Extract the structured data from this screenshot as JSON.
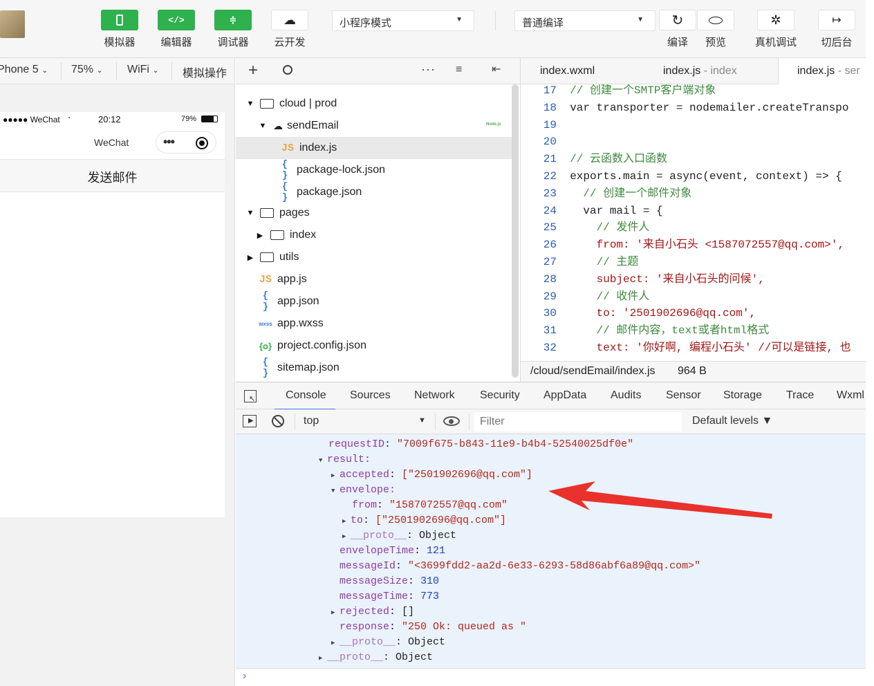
{
  "toolbar": {
    "simulator": "模拟器",
    "editor": "编辑器",
    "debugger": "调试器",
    "cloud": "云开发",
    "mode": "小程序模式",
    "compile_mode": "普通编译",
    "compile": "编译",
    "preview": "预览",
    "device_debug": "真机调试",
    "background": "切后台"
  },
  "sim_bar": {
    "device": "Phone 5",
    "zoom": "75%",
    "network": "WiFi",
    "actions": "模拟操作"
  },
  "phone": {
    "carrier": "●●●●● WeChat",
    "time": "20:12",
    "battery": "79%",
    "title": "WeChat",
    "button": "发送邮件"
  },
  "file_tree": [
    {
      "label": "cloud | prod"
    },
    {
      "label": "sendEmail",
      "badge": "Node.js"
    },
    {
      "label": "index.js"
    },
    {
      "label": "package-lock.json"
    },
    {
      "label": "package.json"
    },
    {
      "label": "pages"
    },
    {
      "label": "index"
    },
    {
      "label": "utils"
    },
    {
      "label": "app.js"
    },
    {
      "label": "app.json"
    },
    {
      "label": "app.wxss"
    },
    {
      "label": "project.config.json"
    },
    {
      "label": "sitemap.json"
    }
  ],
  "editor_tabs": {
    "tab1": "index.wxml",
    "tab2_name": "index.js",
    "tab2_sub": " - index",
    "tab3_name": "index.js",
    "tab3_sub": " - ser"
  },
  "code": [
    {
      "n": "17",
      "t": "  // 创建一个SMTP客户端对象"
    },
    {
      "n": "18",
      "t": "  var transporter = nodemailer.createTranspo"
    },
    {
      "n": "19",
      "t": ""
    },
    {
      "n": "20",
      "t": ""
    },
    {
      "n": "21",
      "t": "  // 云函数入口函数"
    },
    {
      "n": "22",
      "t": "  exports.main = async(event, context) => {"
    },
    {
      "n": "23",
      "t": "    // 创建一个邮件对象"
    },
    {
      "n": "24",
      "t": "    var mail = {"
    },
    {
      "n": "25",
      "t": "      // 发件人"
    },
    {
      "n": "26",
      "t": "      from: '来自小石头 <1587072557@qq.com>',"
    },
    {
      "n": "27",
      "t": "      // 主题"
    },
    {
      "n": "28",
      "t": "      subject: '来自小石头的问候',"
    },
    {
      "n": "29",
      "t": "      // 收件人"
    },
    {
      "n": "30",
      "t": "      to: '2501902696@qq.com',"
    },
    {
      "n": "31",
      "t": "      // 邮件内容，text或者html格式"
    },
    {
      "n": "32",
      "t": "      text: '你好啊, 编程小石头' //可以是链接, 也"
    }
  ],
  "editor_status": {
    "path": "/cloud/sendEmail/index.js",
    "size": "964 B"
  },
  "dev_tabs": [
    "Console",
    "Sources",
    "Network",
    "Security",
    "AppData",
    "Audits",
    "Sensor",
    "Storage",
    "Trace",
    "Wxml"
  ],
  "console_bar": {
    "context": "top",
    "filter_placeholder": "Filter",
    "levels": "Default levels ▼"
  },
  "console_lines": {
    "requestID_key": "requestID",
    "requestID_val": "\"7009f675-b843-11e9-b4b4-52540025df0e\"",
    "result": "result:",
    "accepted_key": "accepted",
    "accepted_val": "[\"2501902696@qq.com\"]",
    "envelope": "envelope:",
    "from_key": "from",
    "from_val": "\"1587072557@qq.com\"",
    "to_key": "to",
    "to_val": "[\"2501902696@qq.com\"]",
    "proto_key": "__proto__",
    "proto_val": "Object",
    "envelopeTime_key": "envelopeTime",
    "envelopeTime_val": "121",
    "messageId_key": "messageId",
    "messageId_val": "\"<3699fdd2-aa2d-6e33-6293-58d86abf6a89@qq.com>\"",
    "messageSize_key": "messageSize",
    "messageSize_val": "310",
    "messageTime_key": "messageTime",
    "messageTime_val": "773",
    "rejected_key": "rejected",
    "rejected_val": "[]",
    "response_key": "response",
    "response_val": "\"250 Ok: queued as \""
  },
  "colors": {
    "green": "#2fb14e",
    "annotation_arrow": "#e8322b",
    "console_bg": "#eaf2fb"
  }
}
